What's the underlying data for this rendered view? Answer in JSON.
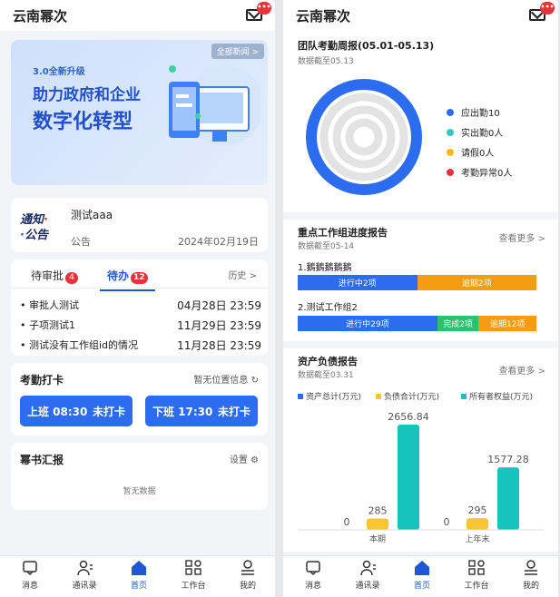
{
  "app_title": "云南幂次",
  "mail_badge": "•••",
  "banner": {
    "more": "全部新闻 >",
    "line1": "3.0全新升级",
    "line2": "助力政府和企业",
    "line3": "数字化转型"
  },
  "notice": {
    "logo_top": "通知",
    "logo_bottom": "公告",
    "title": "测试aaa",
    "tag": "公告",
    "date": "2024年02月19日"
  },
  "tasks": {
    "tab1_label": "待审批",
    "tab1_count": "4",
    "tab2_label": "待办",
    "tab2_count": "12",
    "history": "历史 >",
    "items": [
      {
        "title": "审批人测试",
        "date": "04月28日 23:59"
      },
      {
        "title": "子项测试1",
        "date": "11月29日 23:59"
      },
      {
        "title": "测试没有工作组id的情况",
        "date": "11月28日 23:59"
      }
    ]
  },
  "attendance": {
    "title": "考勤打卡",
    "location": "暂无位置信息",
    "clock_in_label": "上班 08:30",
    "clock_in_status": "未打卡",
    "clock_out_label": "下班 17:30",
    "clock_out_status": "未打卡"
  },
  "report": {
    "title": "幂书汇报",
    "settings": "设置",
    "empty": "暂无数据"
  },
  "tabbar": [
    {
      "label": "消息",
      "icon": "message-icon"
    },
    {
      "label": "通讯录",
      "icon": "contacts-icon"
    },
    {
      "label": "首页",
      "icon": "home-icon"
    },
    {
      "label": "工作台",
      "icon": "workbench-icon"
    },
    {
      "label": "我的",
      "icon": "profile-icon"
    }
  ],
  "weekly": {
    "title": "团队考勤周报(05.01-05.13)",
    "subtitle": "数据截至05.13",
    "legend": [
      {
        "label": "应出勤10",
        "color": "#2b6cf1"
      },
      {
        "label": "实出勤0人",
        "color": "#36c8c0"
      },
      {
        "label": "请假0人",
        "color": "#f5b91a"
      },
      {
        "label": "考勤异常0人",
        "color": "#e8333a"
      }
    ]
  },
  "progress": {
    "title": "重点工作组进度报告",
    "subtitle": "数据截至05-14",
    "more": "查看更多 >",
    "groups": [
      {
        "name": "1.鵝鵝鵝鵝鵝",
        "segments": [
          {
            "label": "进行中2项",
            "value": 2,
            "color": "#2b6cf1"
          },
          {
            "label": "逾期2项",
            "value": 2,
            "color": "#f59c12"
          }
        ]
      },
      {
        "name": "2.测试工作组2",
        "segments": [
          {
            "label": "进行中29项",
            "value": 29,
            "color": "#2b6cf1"
          },
          {
            "label": "完成2项",
            "value": 2,
            "color": "#2cc16e"
          },
          {
            "label": "逾期12项",
            "value": 12,
            "color": "#f59c12"
          }
        ]
      }
    ]
  },
  "balance": {
    "title": "资产负债报告",
    "subtitle": "数据截至03.31",
    "more": "查看更多 >"
  },
  "chart_data": {
    "type": "bar",
    "categories": [
      "本期",
      "上年末"
    ],
    "series": [
      {
        "name": "资产总计(万元)",
        "color": "#2b6cf1",
        "values": [
          0,
          0
        ]
      },
      {
        "name": "负债合计(万元)",
        "color": "#f7c632",
        "values": [
          285,
          295
        ]
      },
      {
        "name": "所有者权益(万元)",
        "color": "#17c3bd",
        "values": [
          2656.84,
          1577.28
        ]
      }
    ],
    "data_labels": [
      [
        "0",
        "285",
        "2656.84"
      ],
      [
        "0",
        "295",
        "1577.28"
      ]
    ]
  }
}
